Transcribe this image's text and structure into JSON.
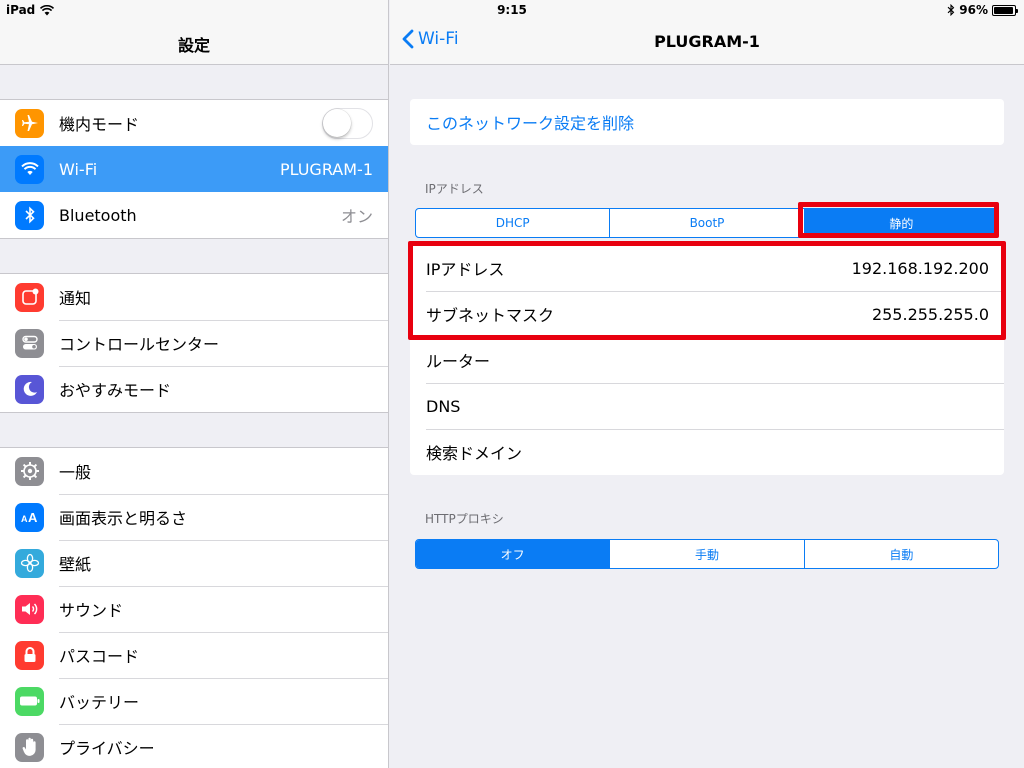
{
  "status": {
    "device": "iPad",
    "time": "9:15",
    "battery": "96%",
    "battery_level": 0.96
  },
  "master": {
    "title": "設定",
    "groups": [
      [
        {
          "label": "機内モード",
          "icon": "airplane-icon",
          "color": "#ff9500",
          "toggle": false
        },
        {
          "label": "Wi-Fi",
          "icon": "wifi-icon",
          "color": "#007aff",
          "value": "PLUGRAM-1",
          "selected": true
        },
        {
          "label": "Bluetooth",
          "icon": "bluetooth-icon",
          "color": "#007aff",
          "value": "オン"
        }
      ],
      [
        {
          "label": "通知",
          "icon": "notification-icon",
          "color": "#ff3b30"
        },
        {
          "label": "コントロールセンター",
          "icon": "control-center-icon",
          "color": "#8e8e93"
        },
        {
          "label": "おやすみモード",
          "icon": "moon-icon",
          "color": "#5856d6"
        }
      ],
      [
        {
          "label": "一般",
          "icon": "gear-icon",
          "color": "#8e8e93"
        },
        {
          "label": "画面表示と明るさ",
          "icon": "display-icon",
          "color": "#007aff"
        },
        {
          "label": "壁紙",
          "icon": "wallpaper-icon",
          "color": "#34aadc"
        },
        {
          "label": "サウンド",
          "icon": "speaker-icon",
          "color": "#ff2d55"
        },
        {
          "label": "パスコード",
          "icon": "lock-icon",
          "color": "#ff3b30"
        },
        {
          "label": "バッテリー",
          "icon": "battery-icon",
          "color": "#4cd964"
        },
        {
          "label": "プライバシー",
          "icon": "hand-icon",
          "color": "#8e8e93"
        }
      ]
    ]
  },
  "detail": {
    "back_label": "Wi-Fi",
    "title": "PLUGRAM-1",
    "delete_label": "このネットワーク設定を削除",
    "ip_section_label": "IPアドレス",
    "ip_modes": [
      "DHCP",
      "BootP",
      "静的"
    ],
    "ip_mode_selected": 2,
    "fields": [
      {
        "label": "IPアドレス",
        "value": "192.168.192.200"
      },
      {
        "label": "サブネットマスク",
        "value": "255.255.255.0"
      },
      {
        "label": "ルーター",
        "value": ""
      },
      {
        "label": "DNS",
        "value": ""
      },
      {
        "label": "検索ドメイン",
        "value": ""
      }
    ],
    "proxy_section_label": "HTTPプロキシ",
    "proxy_modes": [
      "オフ",
      "手動",
      "自動"
    ],
    "proxy_mode_selected": 0,
    "accent_color": "#0a7cf4",
    "highlight_color": "#e8000f"
  }
}
